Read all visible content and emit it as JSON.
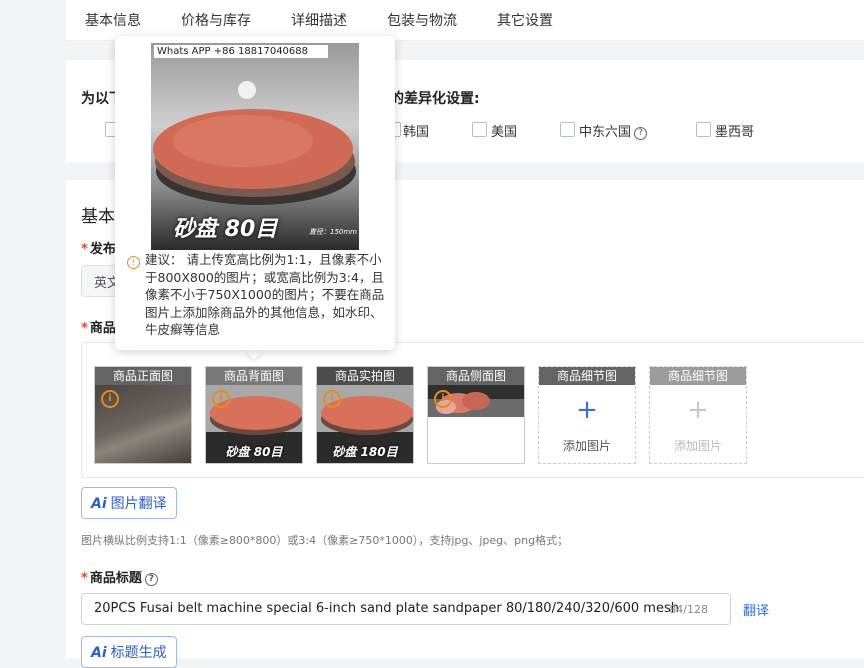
{
  "tabs": [
    "基本信息",
    "价格与库存",
    "详细描述",
    "包装与物流",
    "其它设置"
  ],
  "region": {
    "title_left": "为以下",
    "title_right": "的差异化设置:",
    "options": [
      {
        "label": "韩国",
        "checked": false
      },
      {
        "label": "美国",
        "checked": false
      },
      {
        "label": "中东六国",
        "checked": false,
        "help": true
      },
      {
        "label": "墨西哥",
        "checked": false
      }
    ]
  },
  "basic": {
    "section_title": "基本",
    "publish_label": "发布",
    "publish_value": "英文",
    "images_label": "商品",
    "image_slots": [
      {
        "label": "商品正面图",
        "state": "filled"
      },
      {
        "label": "商品背面图",
        "state": "filled",
        "caption": "砂盘  80目"
      },
      {
        "label": "商品实拍图",
        "state": "filled",
        "caption": "砂盘  180目"
      },
      {
        "label": "商品侧面图",
        "state": "filled"
      },
      {
        "label": "商品细节图",
        "state": "empty",
        "add_text": "添加图片"
      },
      {
        "label": "商品细节图",
        "state": "disabled",
        "add_text": "添加图片"
      }
    ],
    "ai_translate_button": "图片翻译",
    "ai_prefix": "Ai",
    "image_hint": "图片横纵比例支持1:1（像素≥800*800）或3:4（像素≥750*1000），支持jpg、jpeg、png格式；",
    "title_label": "商品标题",
    "title_value": "20PCS Fusai belt machine special 6-inch sand plate sandpaper 80/180/240/320/600 mesh",
    "title_counter": "84/128",
    "translate_link": "翻译",
    "generate_button": "标题生成"
  },
  "popover": {
    "watermark": "Whats APP +86 18817040688",
    "caption": "砂盘  80目",
    "caption_sub": "直径：150mm",
    "suggestion": "建议： 请上传宽高比例为1:1，且像素不小于800X800的图片；或宽高比例为3:4，且像素不小于750X1000的图片；不要在商品图片上添加除商品外的其他信息，如水印、牛皮癣等信息"
  },
  "colors": {
    "accent": "#2f6ed8",
    "required": "#e04a2f",
    "warning": "#e88b1a"
  }
}
